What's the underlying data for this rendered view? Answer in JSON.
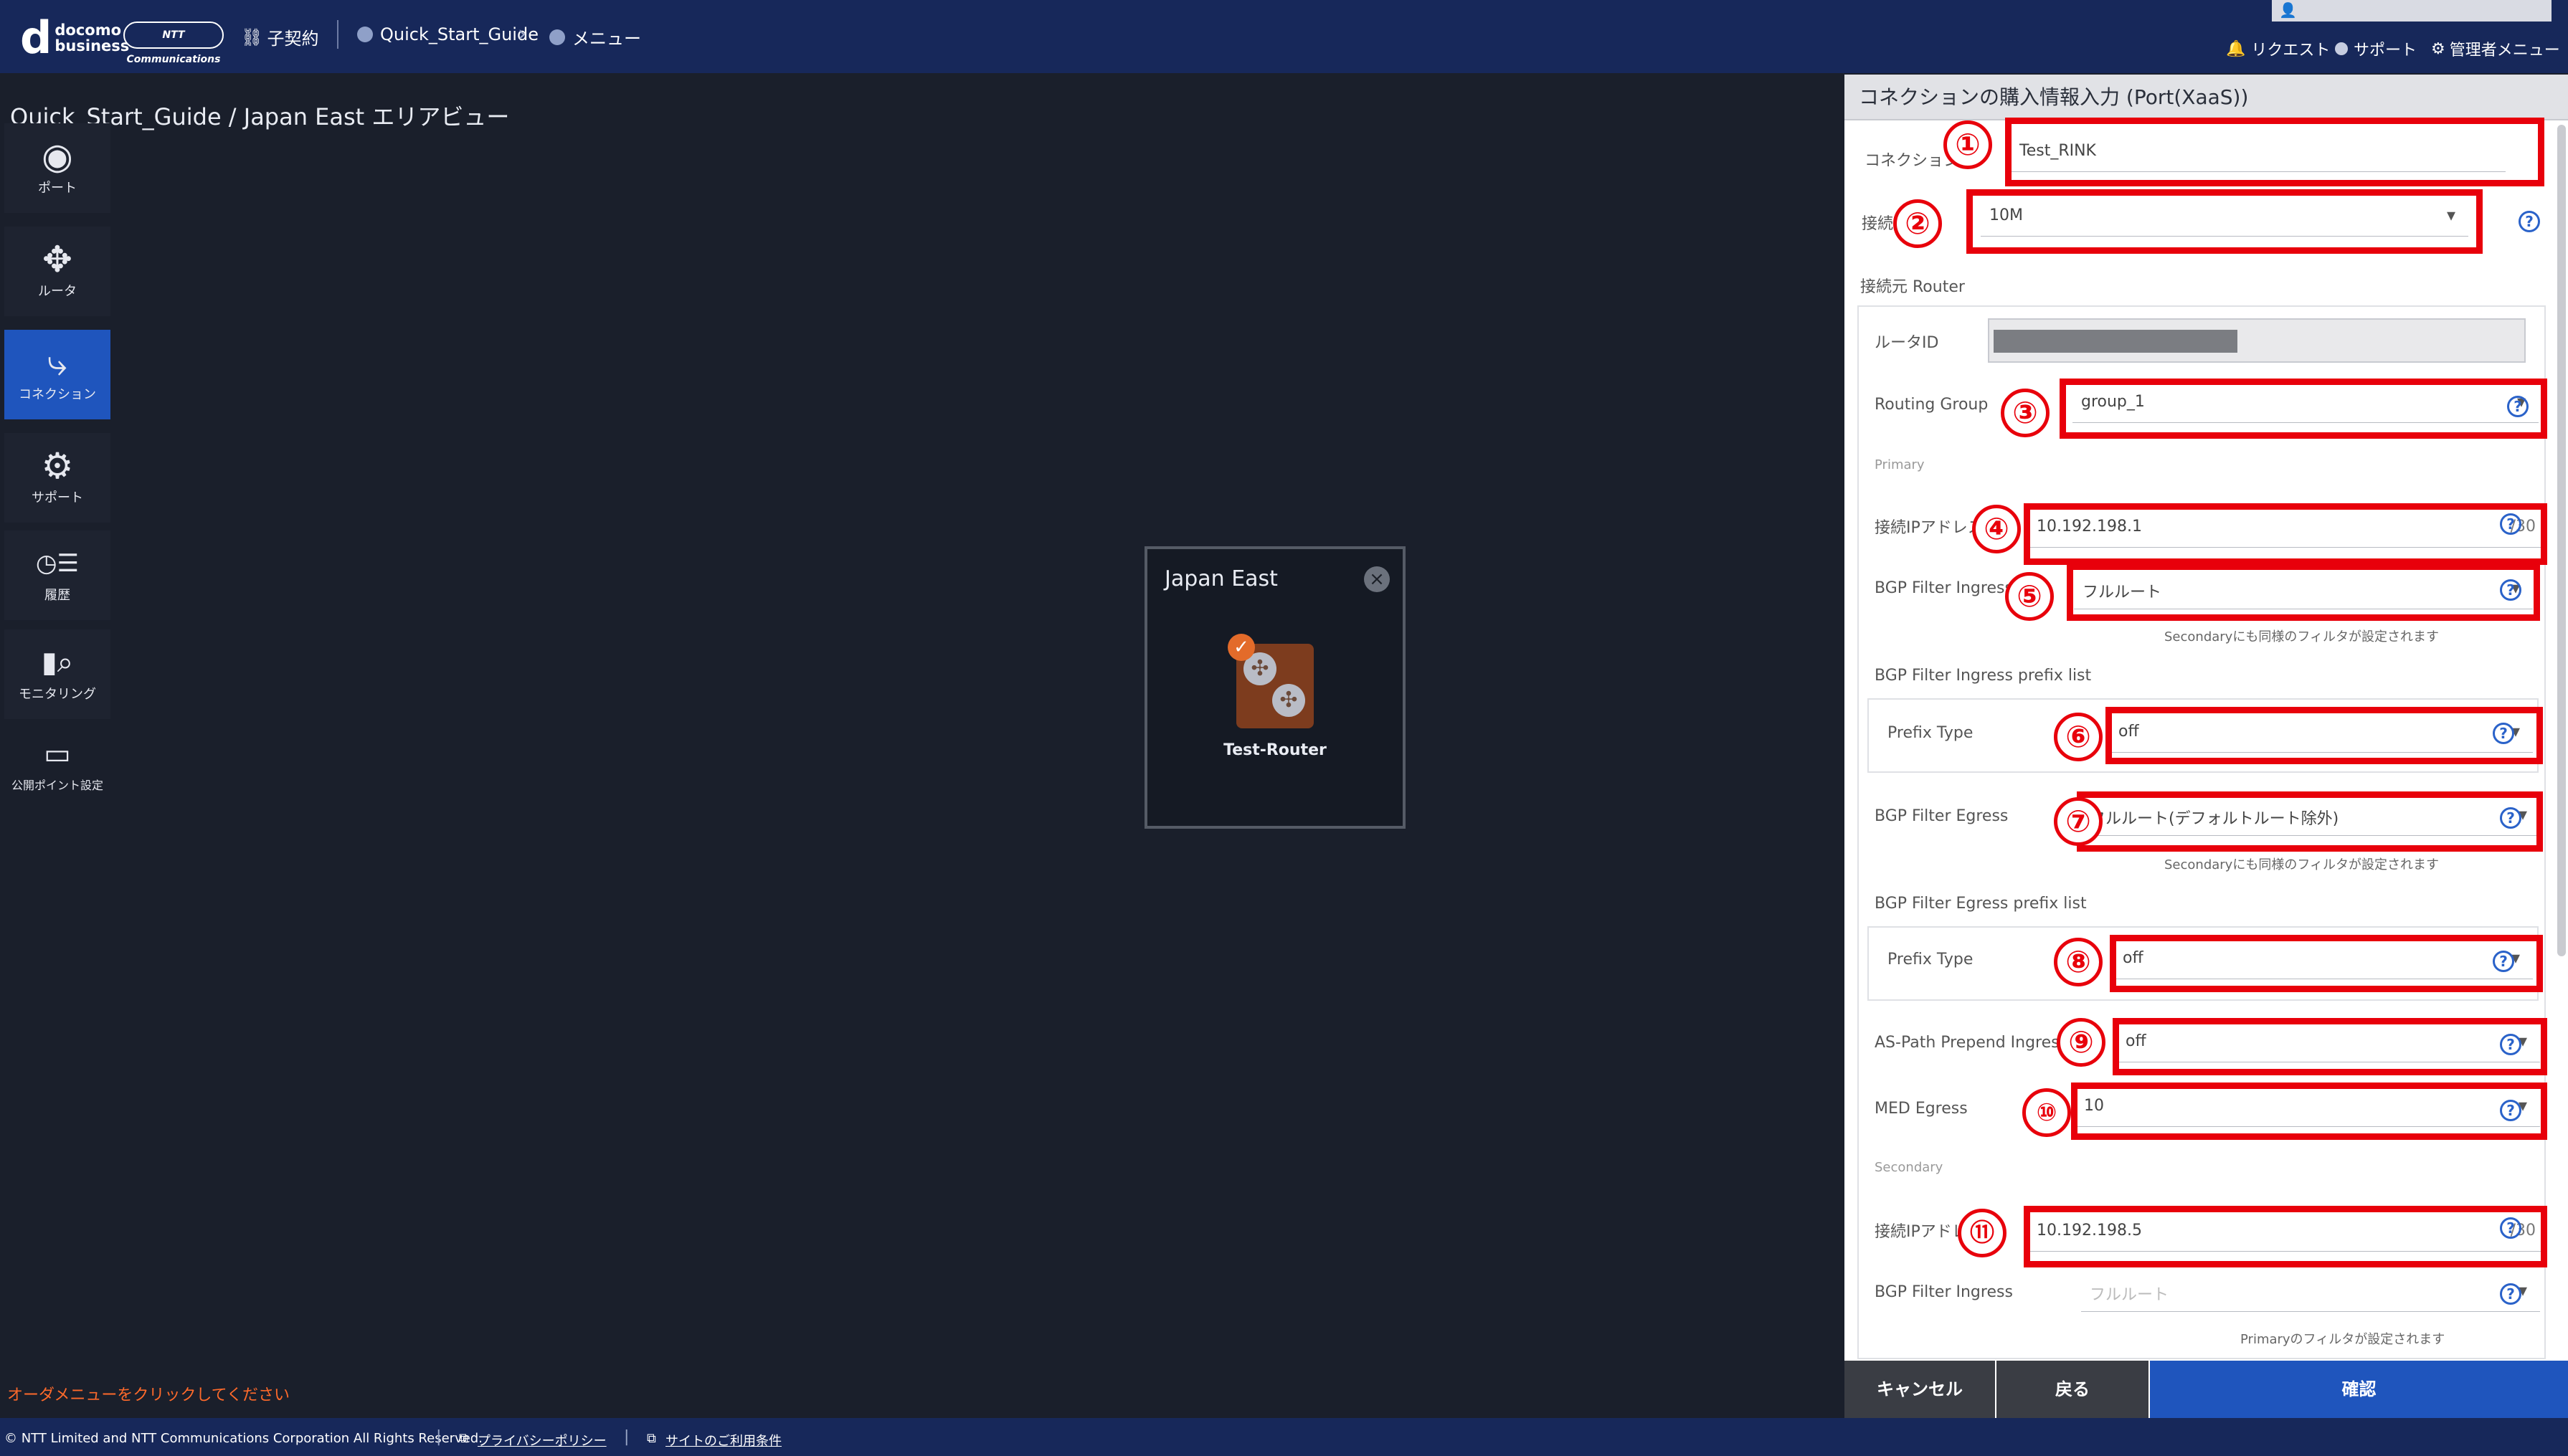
{
  "header": {
    "brand_main": "d",
    "brand_text1": "docomo",
    "brand_text2": "business",
    "brand_ntt": "NTT Communications",
    "contract": "子契約",
    "breadcrumb1": "Quick_Start_Guide",
    "breadcrumb2": "メニュー",
    "request": "リクエスト",
    "support": "サポート",
    "admin": "管理者メニュー"
  },
  "page": {
    "title": "Quick_Start_Guide / Japan East エリアビュー",
    "hint": "オーダメニューをクリックしてください"
  },
  "sidebar": {
    "items": [
      {
        "label": "ポート",
        "icon": "port-icon"
      },
      {
        "label": "ルータ",
        "icon": "router-icon"
      },
      {
        "label": "コネクション",
        "icon": "connection-icon"
      },
      {
        "label": "サポート",
        "icon": "support-icon"
      },
      {
        "label": "履歴",
        "icon": "history-icon"
      },
      {
        "label": "モニタリング",
        "icon": "monitoring-icon"
      },
      {
        "label": "公開ポイント設定",
        "icon": "public-point-icon"
      }
    ]
  },
  "map": {
    "area_title": "Japan East",
    "router_name": "Test-Router"
  },
  "panel": {
    "title": "コネクションの購入情報入力 (Port(XaaS))",
    "connection_name_label": "コネクション名",
    "connection_name_value": "Test_RINK",
    "bandwidth_label": "接続帯域",
    "bandwidth_value": "10M",
    "source_router_label": "接続元 Router",
    "router_id_label": "ルータID",
    "routing_group_label": "Routing Group",
    "routing_group_value": "group_1",
    "primary_label": "Primary",
    "primary_ip_label": "接続IPアドレス",
    "primary_ip_value": "10.192.198.1",
    "ip_suffix": "/30",
    "bgp_ingress_label": "BGP Filter Ingress",
    "bgp_ingress_value": "フルルート",
    "bgp_ingress_note": "Secondaryにも同様のフィルタが設定されます",
    "ingress_prefix_list_label": "BGP Filter Ingress prefix list",
    "prefix_type_label": "Prefix Type",
    "ingress_prefix_type_value": "off",
    "bgp_egress_label": "BGP Filter Egress",
    "bgp_egress_value": "フルルート(デフォルトルート除外)",
    "bgp_egress_note": "Secondaryにも同様のフィルタが設定されます",
    "egress_prefix_list_label": "BGP Filter Egress prefix list",
    "egress_prefix_type_value": "off",
    "as_path_label": "AS-Path Prepend Ingress",
    "as_path_value": "off",
    "med_label": "MED Egress",
    "med_value": "10",
    "secondary_label": "Secondary",
    "secondary_ip_label": "接続IPアドレス",
    "secondary_ip_value": "10.192.198.5",
    "secondary_bgp_ingress_label": "BGP Filter Ingress",
    "secondary_bgp_ingress_value": "フルルート",
    "secondary_note": "Primaryのフィルタが設定されます",
    "cancel": "キャンセル",
    "back": "戻る",
    "confirm": "確認"
  },
  "callouts": [
    "①",
    "②",
    "③",
    "④",
    "⑤",
    "⑥",
    "⑦",
    "⑧",
    "⑨",
    "⑩",
    "⑪"
  ],
  "footer": {
    "copyright": "© NTT Limited and NTT Communications Corporation All Rights Reserved.",
    "privacy": "プライバシーポリシー",
    "terms": "サイトのご利用条件"
  },
  "colors": {
    "topbar": "#17285a",
    "accent": "#1f55bd",
    "callout": "#e8000b",
    "hint": "#ff6a2b"
  }
}
